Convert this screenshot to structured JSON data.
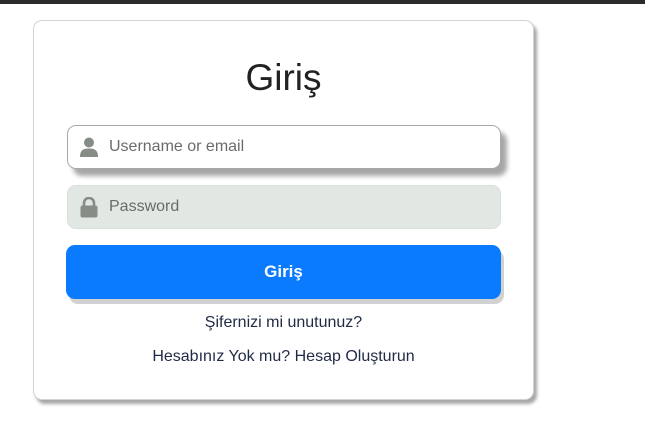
{
  "login": {
    "title": "Giriş",
    "username": {
      "placeholder": "Username or email",
      "value": "",
      "icon": "user-icon"
    },
    "password": {
      "placeholder": "Password",
      "value": "",
      "icon": "lock-icon"
    },
    "submit_label": "Giriş",
    "forgot_password": "Şifernizi mi unutunuz?",
    "register": "Hesabınız Yok mu? Hesap Oluşturun"
  },
  "colors": {
    "accent": "#0a7bff",
    "page_bg": "#ffffff",
    "password_field_bg": "#e1e7e2",
    "icon": "#858d86",
    "link_text": "#1f2a44"
  }
}
